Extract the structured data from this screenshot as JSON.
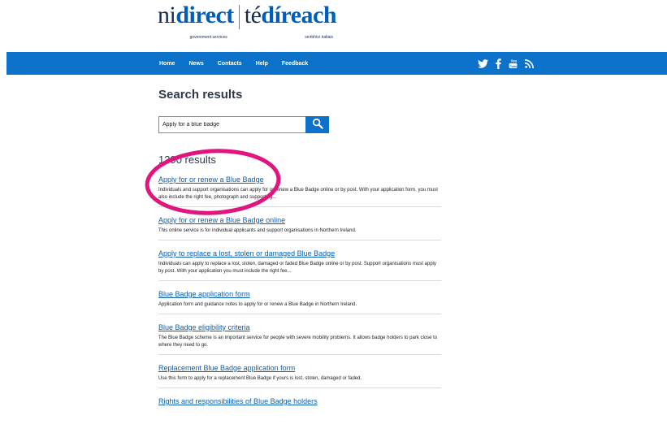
{
  "logo": {
    "brand_ni": "ni",
    "brand_direct": "direct",
    "brand_sub": "government services",
    "alt_te": "té",
    "alt_direach": "díreach",
    "alt_sub": "seirbhísí rialtais"
  },
  "nav": {
    "items": [
      {
        "label": "Home"
      },
      {
        "label": "News"
      },
      {
        "label": "Contacts"
      },
      {
        "label": "Help"
      },
      {
        "label": "Feedback"
      }
    ],
    "social_icons": [
      "twitter-icon",
      "facebook-icon",
      "youtube-icon",
      "rss-icon"
    ]
  },
  "search": {
    "title": "Search results",
    "query": "Apply for a blue badge",
    "button_icon": "search-icon"
  },
  "results_count": "1390 results",
  "results": [
    {
      "title": "Apply for or renew a Blue Badge",
      "snippet": "Individuals and support organisations can apply for or renew a Blue Badge online or by post. With your application form, you must also include the right fee, photograph and supporting..."
    },
    {
      "title": "Apply for or renew a Blue Badge online",
      "snippet": "This online service is for individual applicants and support organisations in Northern Ireland."
    },
    {
      "title": "Apply to replace a lost, stolen or damaged Blue Badge",
      "snippet": "Individuals can apply to replace a lost, stolen, damaged or faded Blue Badge online or by post. Support organisations must apply by post. With your application you must include the right fee..."
    },
    {
      "title": "Blue Badge application form",
      "snippet": "Application form and guidance notes to apply for or renew a Blue Badge in Northern Ireland."
    },
    {
      "title": "Blue Badge eligibility criteria",
      "snippet": "The Blue Badge scheme is an important service for people with severe mobility problems. It allows badge holders to park close to where they need to go."
    },
    {
      "title": "Replacement Blue Badge application form",
      "snippet": "Use this form to apply for a replacement Blue Badge if yours is lost, stolen, damaged or faded."
    },
    {
      "title": "Rights and responsibilities of Blue Badge holders",
      "snippet": ""
    }
  ],
  "colors": {
    "nav_bg": "#0c72c9",
    "link": "#0b5fb0",
    "highlight": "#e0157d"
  }
}
